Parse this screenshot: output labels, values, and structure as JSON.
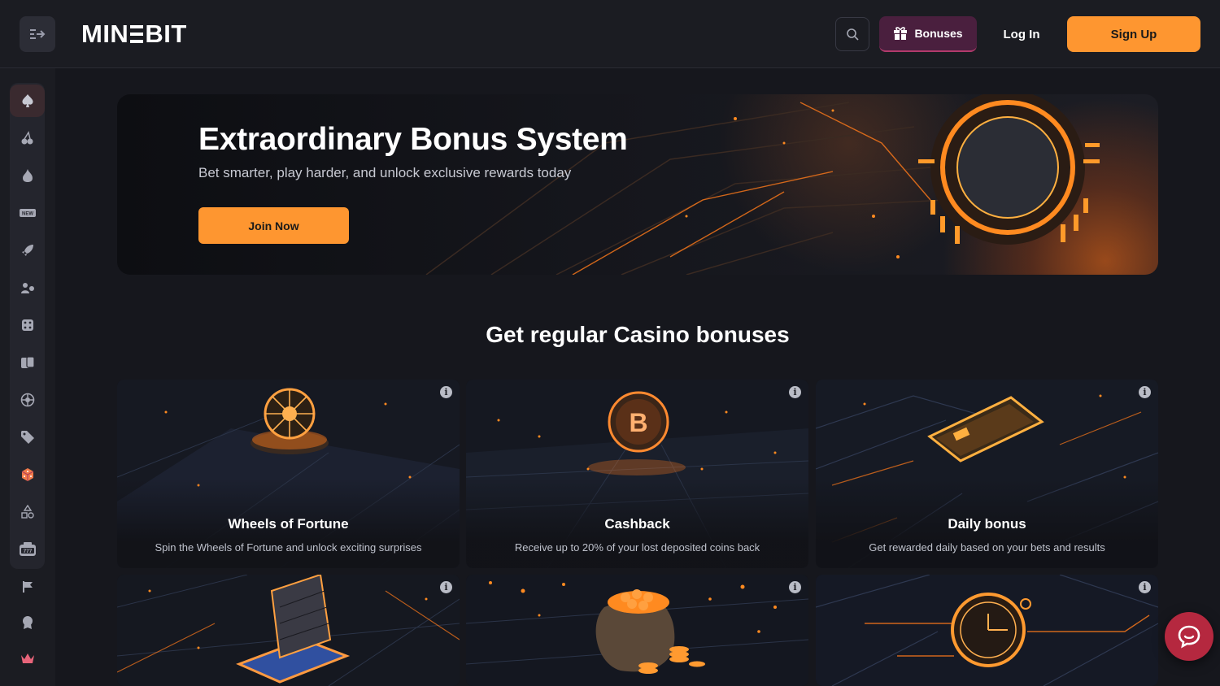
{
  "brand": {
    "logo_text_left": "MIN",
    "logo_text_right": "BIT",
    "accent": "#fe9630"
  },
  "header": {
    "menu_icon": "sidebar-toggle-icon",
    "search_icon": "search-icon",
    "bonuses_label": "Bonuses",
    "login_label": "Log In",
    "signup_label": "Sign Up"
  },
  "sidebar": {
    "items": [
      {
        "icon": "spade-icon",
        "active": true
      },
      {
        "icon": "cherry-icon"
      },
      {
        "icon": "flame-icon"
      },
      {
        "icon": "new-badge-icon",
        "text": "NEW"
      },
      {
        "icon": "rocket-icon"
      },
      {
        "icon": "live-dealer-icon"
      },
      {
        "icon": "dice-icon"
      },
      {
        "icon": "cards-icon"
      },
      {
        "icon": "roulette-icon"
      },
      {
        "icon": "tag-icon"
      },
      {
        "icon": "provably-fair-dice-icon"
      },
      {
        "icon": "shapes-icon"
      },
      {
        "icon": "slot-machine-icon",
        "text": "777"
      }
    ],
    "extra": [
      {
        "icon": "flag-icon"
      },
      {
        "icon": "award-icon"
      },
      {
        "icon": "crown-icon"
      }
    ]
  },
  "hero": {
    "title": "Extraordinary Bonus System",
    "subtitle": "Bet smarter, play harder, and unlock exclusive rewards today",
    "cta": "Join Now"
  },
  "section": {
    "title": "Get regular Casino bonuses"
  },
  "cards": [
    {
      "title": "Wheels of Fortune",
      "desc": "Spin the Wheels of Fortune and unlock exciting surprises",
      "art": "wheel"
    },
    {
      "title": "Cashback",
      "desc": "Receive up to 20% of your lost deposited coins back",
      "art": "bitcoin"
    },
    {
      "title": "Daily bonus",
      "desc": "Get rewarded daily based on your bets and results",
      "art": "card"
    },
    {
      "title": "",
      "desc": "",
      "art": "calendar"
    },
    {
      "title": "",
      "desc": "",
      "art": "coins"
    },
    {
      "title": "",
      "desc": "",
      "art": "stopwatch"
    }
  ],
  "card_info_glyph": "i",
  "chat": {
    "icon": "chat-bubble-icon"
  }
}
